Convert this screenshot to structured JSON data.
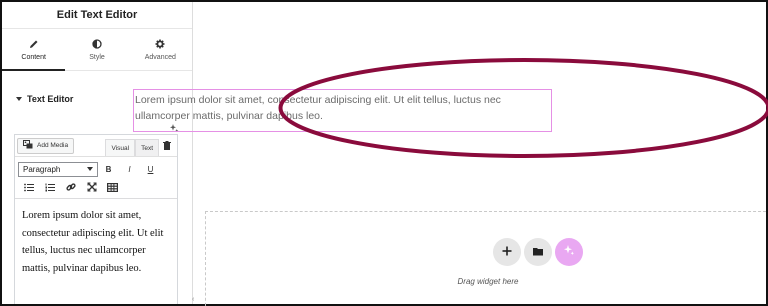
{
  "panel": {
    "title": "Edit Text Editor",
    "tabs": [
      {
        "label": "Content",
        "icon": "pencil-icon"
      },
      {
        "label": "Style",
        "icon": "half-circle-icon"
      },
      {
        "label": "Advanced",
        "icon": "gear-icon"
      }
    ],
    "section_title": "Text Editor"
  },
  "editor": {
    "add_media_label": "Add Media",
    "visual_tab": "Visual",
    "text_tab": "Text",
    "format_select": "Paragraph",
    "bold": "B",
    "italic": "I",
    "underline": "U",
    "content": "Lorem ipsum dolor sit amet, consectetur adipiscing elit. Ut elit tellus, luctus nec ullamcorper mattis, pulvinar dapibus leo."
  },
  "canvas": {
    "text_widget": "Lorem ipsum dolor sit amet, consectetur adipiscing elit. Ut elit tellus, luctus nec ullamcorper mattis, pulvinar dapibus leo.",
    "drop_label": "Drag widget here"
  },
  "colors": {
    "highlight_ellipse": "#8a0b3c",
    "widget_border": "#e590e5",
    "ai_button": "#e9a8f2"
  }
}
